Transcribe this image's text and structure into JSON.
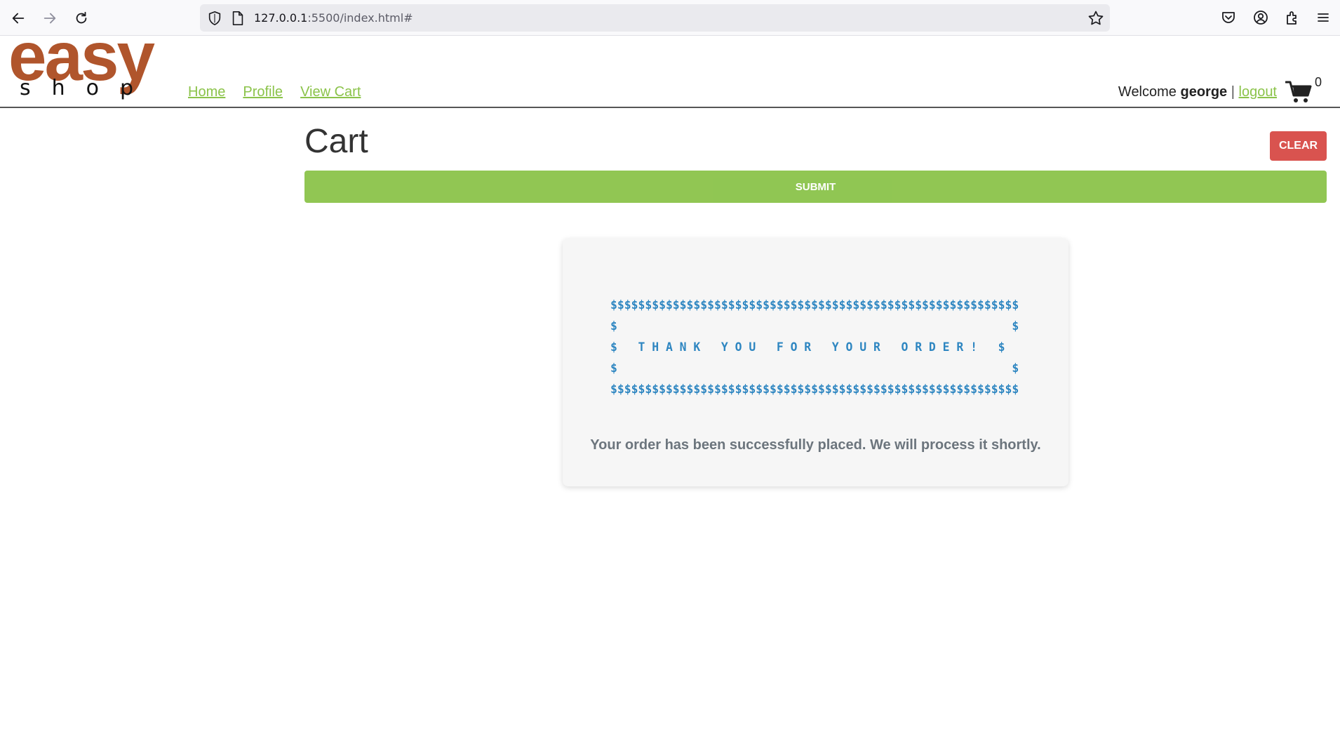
{
  "browser": {
    "url_host": "127.0.0.1",
    "url_path": ":5500/index.html#",
    "icons": [
      "back-icon",
      "forward-icon",
      "reload-icon",
      "shield-icon",
      "page-icon",
      "bookmark-star-icon",
      "pocket-icon",
      "account-icon",
      "extensions-icon",
      "menu-icon"
    ]
  },
  "header": {
    "logo_top": "easy",
    "logo_bottom": "shop",
    "nav": {
      "home": "Home",
      "profile": "Profile",
      "view_cart": "View Cart"
    },
    "welcome": "Welcome",
    "username": "george",
    "separator": "|",
    "logout": "logout",
    "cart_count": "0"
  },
  "cart": {
    "title": "Cart",
    "clear_label": "CLEAR",
    "submit_label": "SUBMIT"
  },
  "order": {
    "banner": "$$$$$$$$$$$$$$$$$$$$$$$$$$$$$$$$$$$$$$$$$$$$$$$$$$$$$$$$$$$\n$                                                         $\n$   T H A N K   Y O U   F O R   Y O U R   O R D E R !   $\n$                                                         $\n$$$$$$$$$$$$$$$$$$$$$$$$$$$$$$$$$$$$$$$$$$$$$$$$$$$$$$$$$$$",
    "message": "Your order has been successfully placed. We will process it shortly."
  },
  "colors": {
    "brand": "#b0552c",
    "link": "#8bc34a",
    "submit": "#8bc34a",
    "clear": "#d9534f",
    "banner": "#2e86c1"
  }
}
